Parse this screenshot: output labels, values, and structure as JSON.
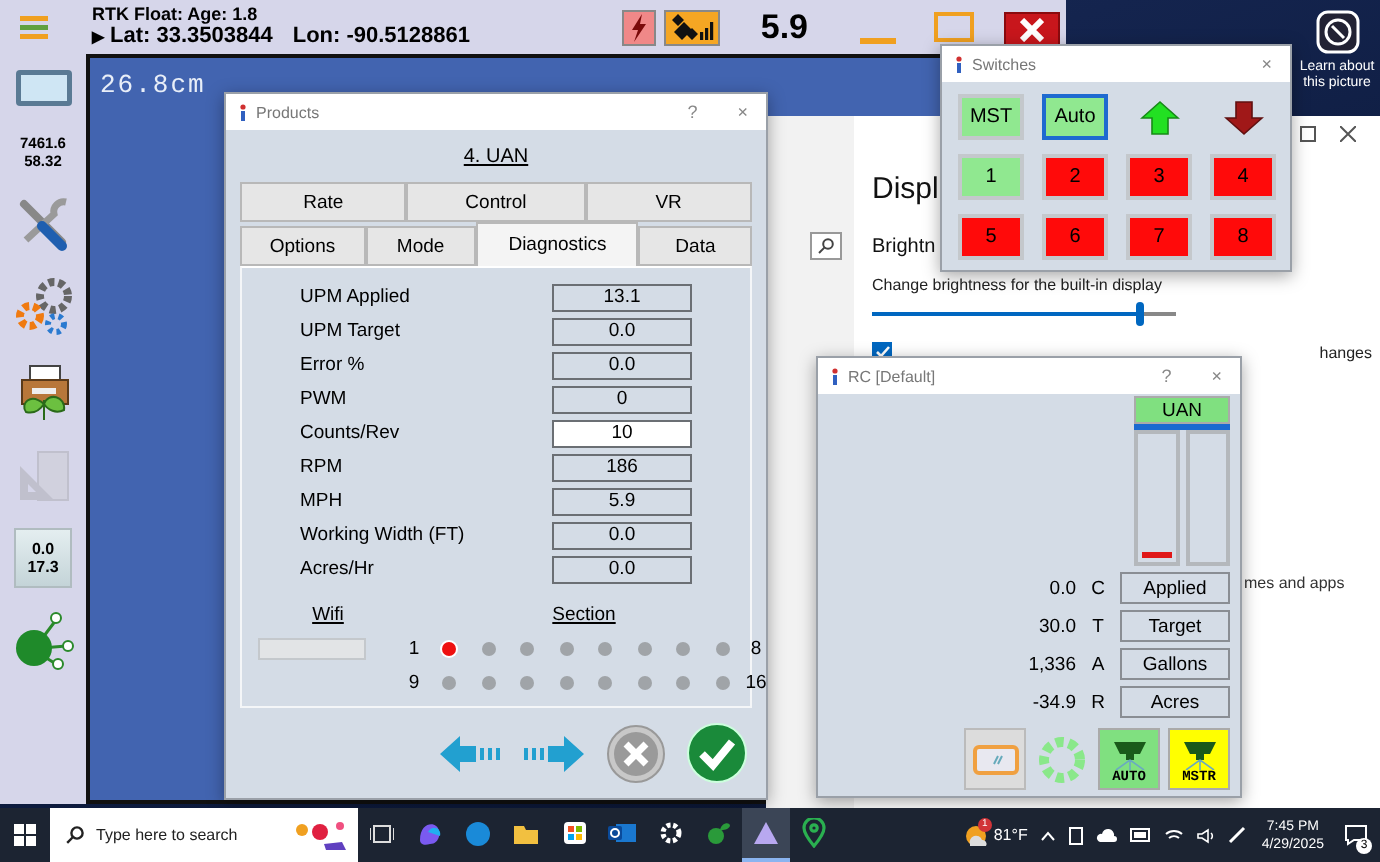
{
  "app": {
    "status": "RTK Float: Age: 1.8",
    "position_marker": "▶",
    "latitude": "Lat: 33.3503844",
    "longitude": "Lon: -90.5128861",
    "speed": "5.9",
    "map_scale": "26.8cm",
    "counters": [
      "7461.6",
      "58.32"
    ],
    "readout": [
      "0.0",
      "17.3"
    ],
    "tools": [
      {
        "kind": "wrench",
        "disabled": false
      },
      {
        "kind": "gears",
        "disabled": false
      },
      {
        "kind": "printer",
        "disabled": false
      },
      {
        "kind": "ruler",
        "disabled": true
      }
    ]
  },
  "settings": {
    "heading": "Displ",
    "subheading": "Brightn",
    "brightness": {
      "label": "Change brightness for the built-in display",
      "level": 0.88
    },
    "auto_brightness": {
      "checked": true,
      "text": "hanges"
    },
    "partial_text": "mes and apps"
  },
  "products": {
    "title": "Products",
    "help": "?",
    "close": "×",
    "product": "4. UAN",
    "tab_rows": [
      {
        "tabs": [
          {
            "label": "Rate",
            "selected": false
          },
          {
            "label": "Control",
            "selected": false
          },
          {
            "label": "VR",
            "selected": false
          }
        ]
      },
      {
        "tabs": [
          {
            "label": "Options",
            "selected": false
          },
          {
            "label": "Mode",
            "selected": false
          },
          {
            "label": "Diagnostics",
            "selected": true
          },
          {
            "label": "Data",
            "selected": false
          }
        ]
      }
    ],
    "rows": [
      {
        "label": "UPM Applied",
        "value": "13.1",
        "editable": false
      },
      {
        "label": "UPM Target",
        "value": "0.0",
        "editable": false
      },
      {
        "label": "Error %",
        "value": "0.0",
        "editable": false
      },
      {
        "label": "PWM",
        "value": "0",
        "editable": false
      },
      {
        "label": "Counts/Rev",
        "value": "10",
        "editable": true
      },
      {
        "label": "RPM",
        "value": "186",
        "editable": false
      },
      {
        "label": "MPH",
        "value": "5.9",
        "editable": false
      },
      {
        "label": "Working Width (FT)",
        "value": "0.0",
        "editable": false
      },
      {
        "label": "Acres/Hr",
        "value": "0.0",
        "editable": false
      }
    ],
    "wifi_label": "Wifi",
    "section_label": "Section",
    "section_rows": [
      {
        "start": "1",
        "end": "8",
        "sections": [
          {
            "on": true
          },
          {
            "on": false
          },
          {
            "on": false
          },
          {
            "on": false
          },
          {
            "on": false
          },
          {
            "on": false
          },
          {
            "on": false
          },
          {
            "on": false
          }
        ]
      },
      {
        "start": "9",
        "end": "16",
        "sections": [
          {
            "on": false
          },
          {
            "on": false
          },
          {
            "on": false
          },
          {
            "on": false
          },
          {
            "on": false
          },
          {
            "on": false
          },
          {
            "on": false
          },
          {
            "on": false
          }
        ]
      }
    ]
  },
  "switches": {
    "title": "Switches",
    "close": "×",
    "modes": [
      {
        "label": "MST",
        "focused": false
      },
      {
        "label": "Auto",
        "focused": true
      }
    ],
    "sections": [
      {
        "label": "1",
        "on": true
      },
      {
        "label": "2",
        "on": false
      },
      {
        "label": "3",
        "on": false
      },
      {
        "label": "4",
        "on": false
      },
      {
        "label": "5",
        "on": false
      },
      {
        "label": "6",
        "on": false
      },
      {
        "label": "7",
        "on": false
      },
      {
        "label": "8",
        "on": false
      }
    ]
  },
  "rc": {
    "title": "RC [Default]",
    "help": "?",
    "close": "×",
    "product": "UAN",
    "level": 0.04,
    "readings": [
      {
        "value": "0.0",
        "code": "C",
        "label": "Applied"
      },
      {
        "value": "30.0",
        "code": "T",
        "label": "Target"
      },
      {
        "value": "1,336",
        "code": "A",
        "label": "Gallons"
      },
      {
        "value": "-34.9",
        "code": "R",
        "label": "Acres"
      }
    ],
    "modes": [
      {
        "label": "AUTO",
        "color": "#80e080"
      },
      {
        "label": "MSTR",
        "color": "#ffff00"
      }
    ]
  },
  "desktop": {
    "spotlight": "Learn about this picture"
  },
  "taskbar": {
    "search_placeholder": "Type here to search",
    "apps": [
      {
        "kind": "taskview",
        "selected": false
      },
      {
        "kind": "copilot",
        "selected": false
      },
      {
        "kind": "edge",
        "selected": false
      },
      {
        "kind": "folder",
        "selected": false
      },
      {
        "kind": "store",
        "selected": false
      },
      {
        "kind": "mail",
        "selected": false
      },
      {
        "kind": "settings",
        "selected": false
      },
      {
        "kind": "sprout",
        "selected": false
      },
      {
        "kind": "triangle",
        "selected": true
      },
      {
        "kind": "pin",
        "selected": false
      }
    ],
    "weather_badge": "1",
    "temperature": "81°F",
    "time": "7:45 PM",
    "date": "4/29/2025",
    "notifications": "3"
  }
}
